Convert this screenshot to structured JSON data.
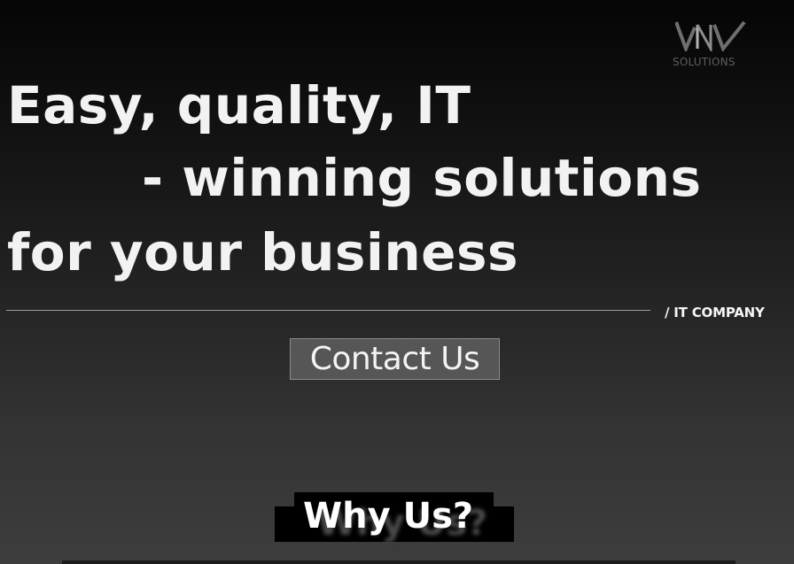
{
  "brand": {
    "logo_icon": "wn-monogram-logo",
    "logo_text": "SOLUTIONS",
    "logo_color": "#6b6b6b"
  },
  "hero": {
    "line1": "Easy, quality, IT",
    "line2": "- winning solutions",
    "line3": "for your business",
    "tag": "/ IT COMPANY",
    "cta_label": "Contact Us"
  },
  "section": {
    "title": "Why Us?"
  },
  "colors": {
    "background_top": "#050505",
    "background_bottom": "#3d3d3d",
    "text": "#f2f2f2",
    "button_bg": "#565656"
  }
}
